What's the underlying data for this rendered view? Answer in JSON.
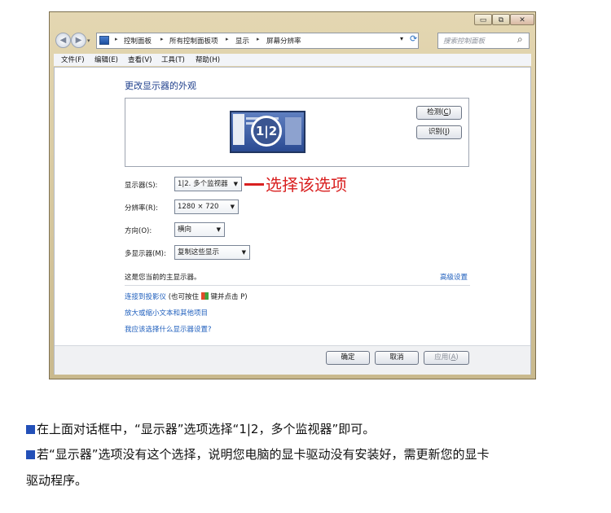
{
  "window": {
    "caption_min": "▭",
    "caption_restore": "⧉",
    "caption_close": "✕"
  },
  "address": {
    "crumbs": [
      "控制面板",
      "所有控制面板项",
      "显示",
      "屏幕分辨率"
    ],
    "search_placeholder": "搜索控制面板",
    "refresh_icon": "⟳",
    "search_icon": "⌕"
  },
  "menu": {
    "items": [
      "文件(F)",
      "编辑(E)",
      "查看(V)",
      "工具(T)",
      "帮助(H)"
    ]
  },
  "main": {
    "heading": "更改显示器的外观",
    "monitor_numbers": "1|2",
    "detect_label": "检测",
    "detect_key": "C",
    "identify_label": "识别",
    "identify_key": "I",
    "display_label": "显示器(S):",
    "display_value": "1|2. 多个监视器",
    "annotation": "选择该选项",
    "resolution_label": "分辨率(R):",
    "resolution_value": "1280 × 720",
    "orientation_label": "方向(O):",
    "orientation_value": "横向",
    "multi_label": "多显示器(M):",
    "multi_value": "复制这些显示",
    "primary_note": "这是您当前的主显示器。",
    "advanced_link": "高级设置",
    "projector_link": "连接到投影仪",
    "projector_hint_pre": "(也可按住",
    "projector_hint_post": "键并点击 P)",
    "text_size_link": "放大或缩小文本和其他项目",
    "which_link": "我应该选择什么显示器设置?",
    "ok_label": "确定",
    "cancel_label": "取消",
    "apply_label": "应用",
    "apply_key": "A"
  },
  "instructions": {
    "line1": "在上面对话框中，“显示器”选项选择“1|2，多个监视器”即可。",
    "line2": "若“显示器”选项没有这个选择，说明您电脑的显卡驱动没有安装好，需更新您的显卡",
    "line3": "驱动程序。"
  },
  "colors": {
    "annotation": "#d92020",
    "bullet": "#2350b8",
    "link": "#1f5fbd"
  }
}
